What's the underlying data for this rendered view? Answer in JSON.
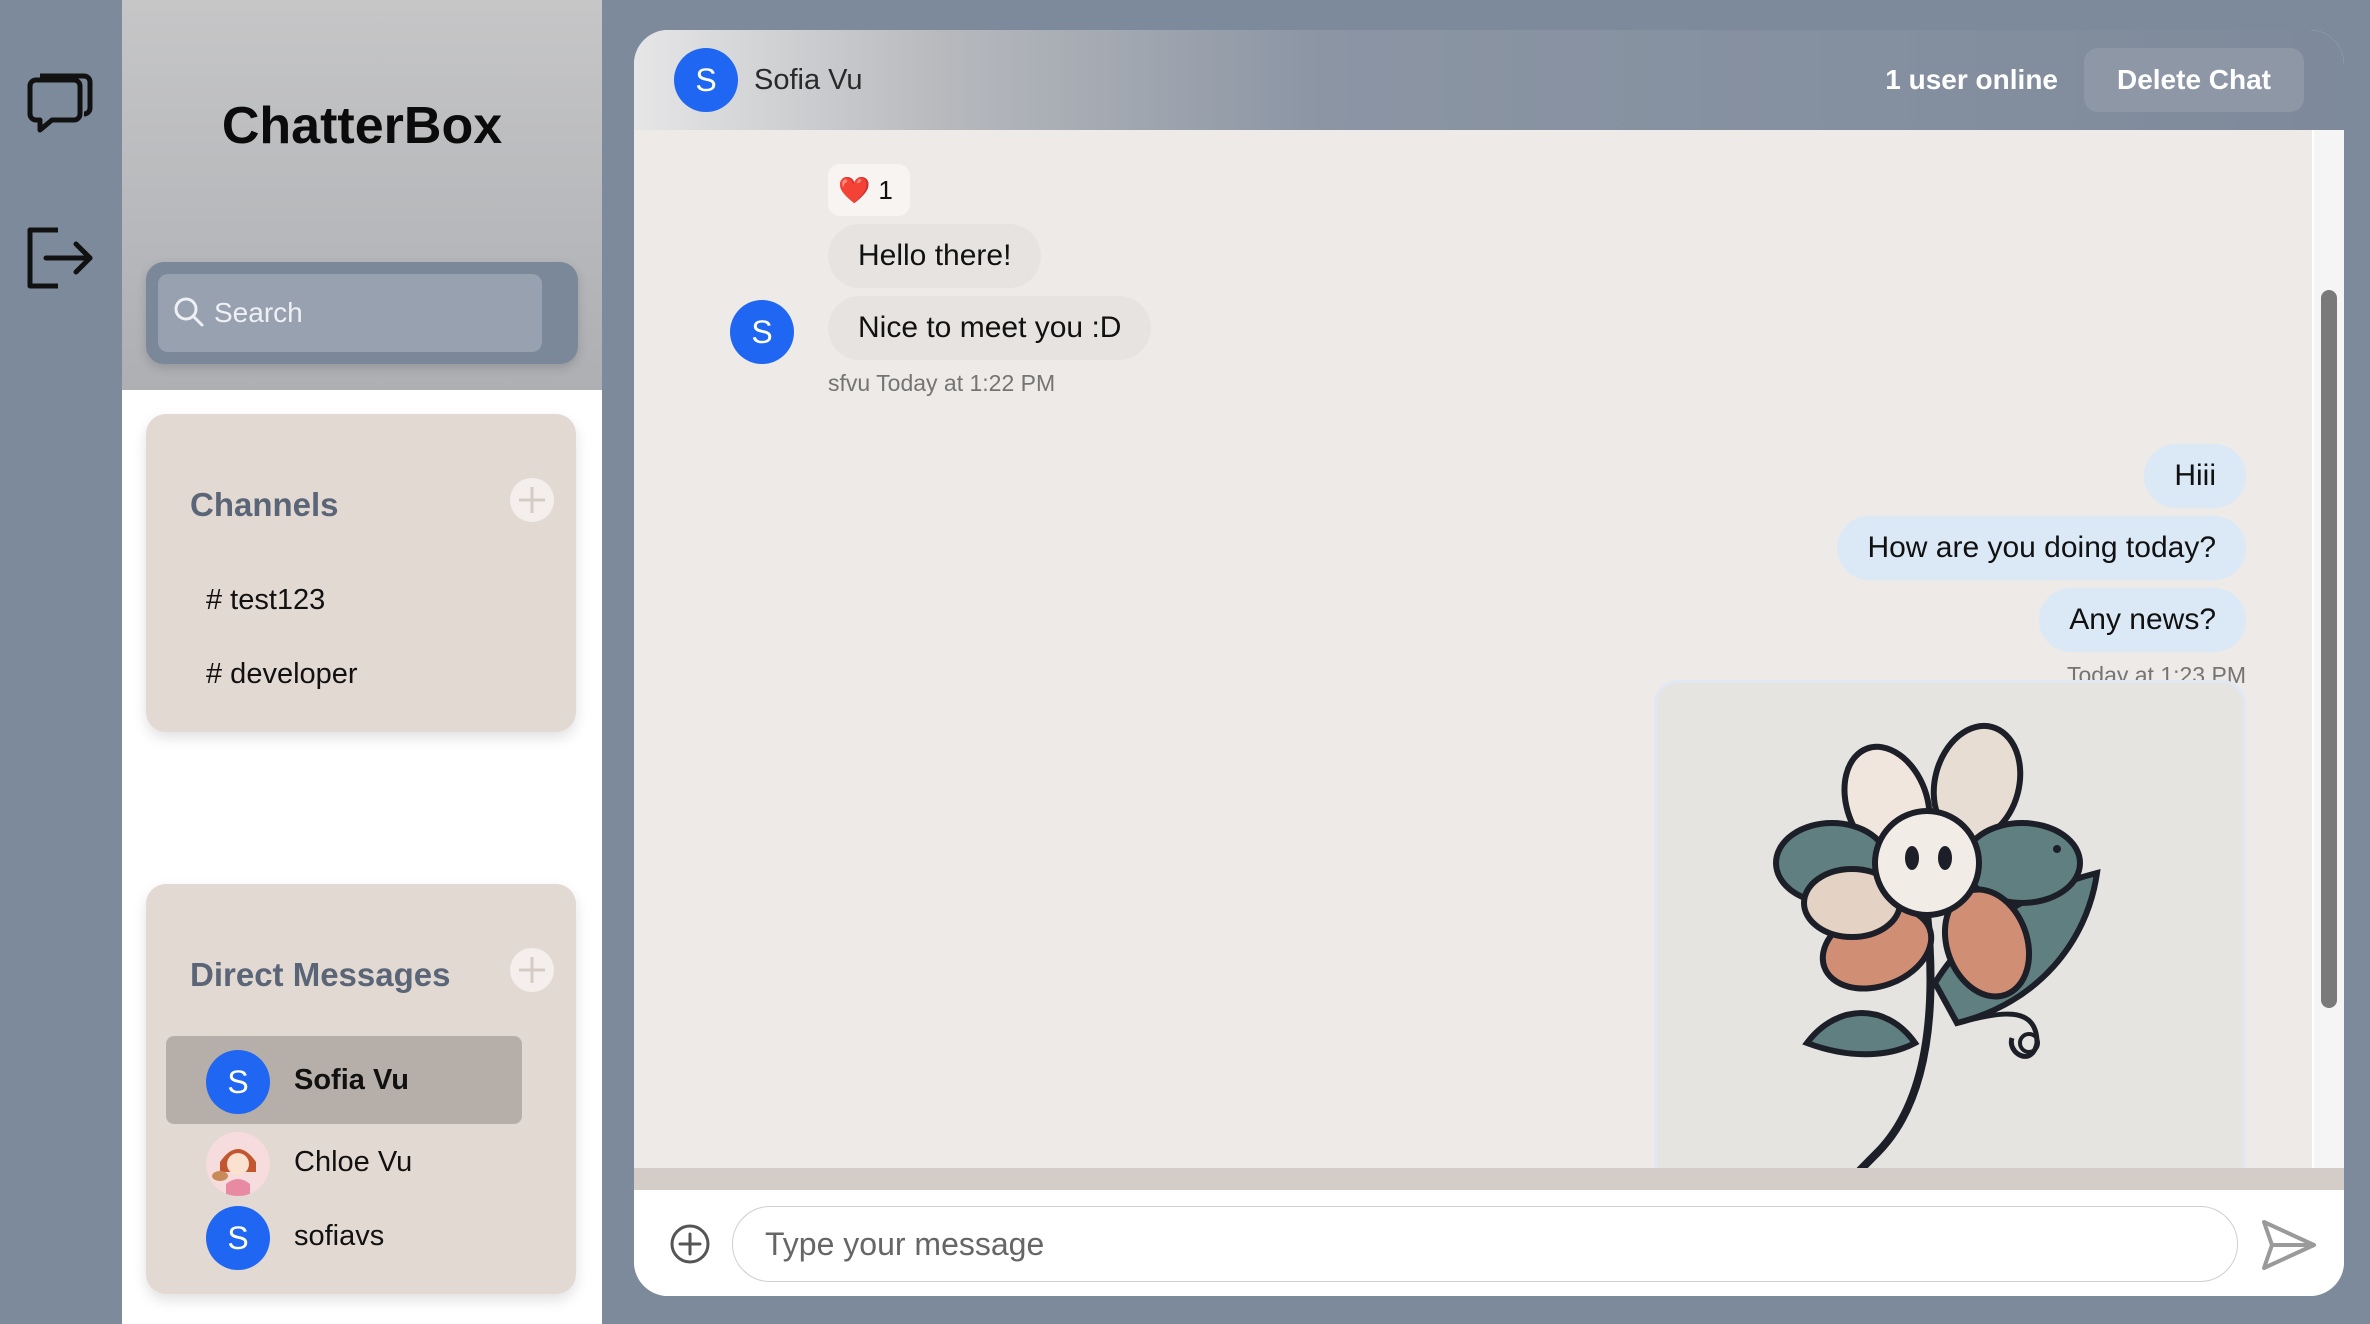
{
  "rail": {
    "chat_icon": "chat-bubbles-icon",
    "logout_icon": "logout-icon"
  },
  "sidebar": {
    "brand": "ChatterBox",
    "search": {
      "placeholder": "Search",
      "value": ""
    },
    "channels": {
      "title": "Channels",
      "items": [
        {
          "label": "# test123"
        },
        {
          "label": "# developer"
        }
      ]
    },
    "direct_messages": {
      "title": "Direct Messages",
      "items": [
        {
          "avatar": "S",
          "name": "Sofia Vu",
          "active": true
        },
        {
          "avatar": "photo",
          "name": "Chloe Vu",
          "active": false
        },
        {
          "avatar": "S",
          "name": "sofiavs",
          "active": false
        }
      ]
    }
  },
  "chat": {
    "header": {
      "avatar": "S",
      "name": "Sofia Vu",
      "online": "1 user online",
      "delete_label": "Delete Chat"
    },
    "reaction": {
      "emoji": "❤️",
      "count": "1"
    },
    "incoming": {
      "avatar": "S",
      "messages": [
        "Hello there!",
        "Nice to meet you :D"
      ],
      "meta": "sfvu  Today at 1:22 PM"
    },
    "outgoing": {
      "messages": [
        "Hiii",
        "How are you doing today?",
        "Any news?"
      ],
      "meta": "Today at 1:23 PM"
    },
    "composer": {
      "placeholder": "Type your message",
      "value": ""
    }
  },
  "colors": {
    "accent_blue": "#1f66f2",
    "rail_bg": "#7d8a9b",
    "card_bg": "#e3d9d3",
    "message_bg": "#eeeae7",
    "outgoing_bubble": "#dbe8f6"
  }
}
